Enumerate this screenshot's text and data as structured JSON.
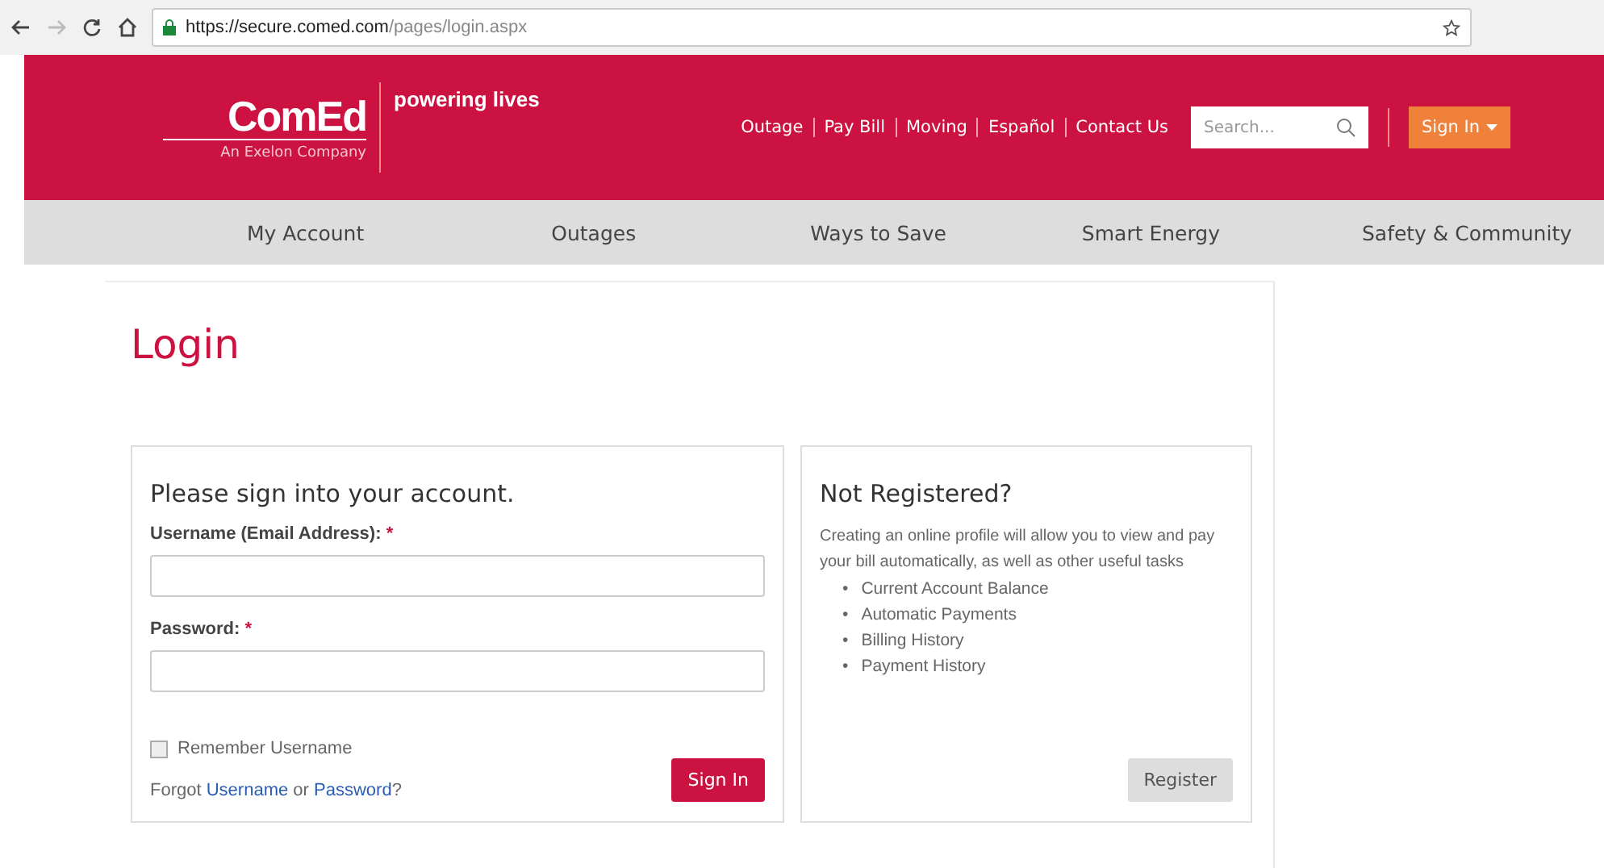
{
  "browser": {
    "url_host": "https://secure.comed.com",
    "url_path": "/pages/login.aspx"
  },
  "header": {
    "logo": "ComEd",
    "logo_sub": "An Exelon Company",
    "tagline": "powering lives",
    "links": [
      "Outage",
      "Pay Bill",
      "Moving",
      "Español",
      "Contact Us"
    ],
    "search": {
      "placeholder": "Search..."
    },
    "sign_in": "Sign In"
  },
  "nav": [
    "My Account",
    "Outages",
    "Ways to Save",
    "Smart Energy",
    "Safety & Community"
  ],
  "page_title": "Login",
  "login": {
    "title": "Please sign into your account.",
    "fields": [
      {
        "label": "Username (Email Address):",
        "required_mark": "*"
      },
      {
        "label": "Password:",
        "required_mark": "*"
      }
    ],
    "remember": {
      "label": "Remember Username",
      "checked": false
    },
    "forgot": {
      "prefix": "Forgot",
      "link1": "Username",
      "middle": "or",
      "link2": "Password",
      "suffix": "?"
    },
    "button": "Sign In"
  },
  "register": {
    "title": "Not Registered?",
    "text": "Creating an online profile will allow you to view and pay your bill automatically, as well as other useful tasks",
    "items": [
      {
        "bullet": "•",
        "text": "Current Account Balance"
      },
      {
        "bullet": "•",
        "text": "Automatic Payments"
      },
      {
        "bullet": "•",
        "text": "Billing History"
      },
      {
        "bullet": "•",
        "text": "Payment History"
      }
    ],
    "button": "Register"
  }
}
